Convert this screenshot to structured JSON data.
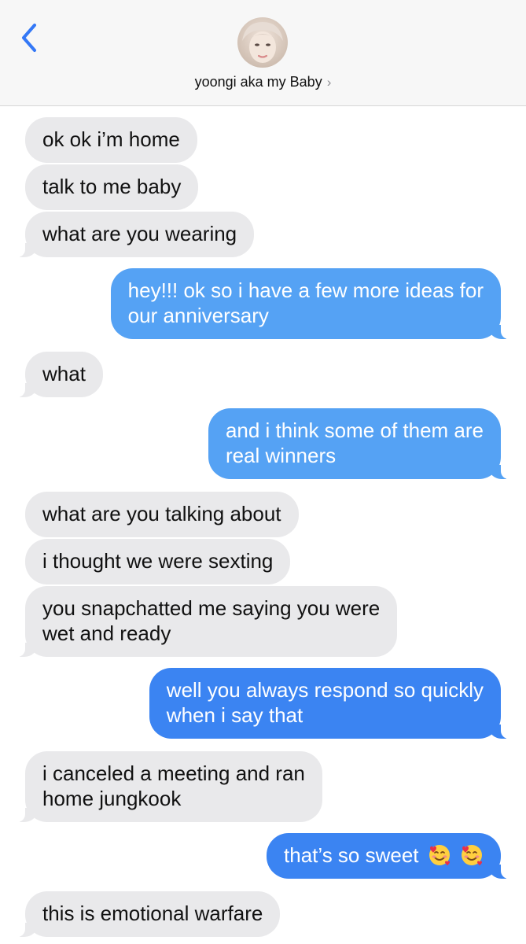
{
  "header": {
    "contact_name": "yoongi aka my Baby",
    "chevron": "›"
  },
  "messages": [
    {
      "side": "in",
      "text": "ok ok i’m home"
    },
    {
      "side": "in",
      "text": "talk to me baby"
    },
    {
      "side": "in",
      "text": "what are you wearing"
    },
    {
      "side": "out",
      "lines": [
        "hey!!! ok so i have a few more ideas for",
        "our anniversary"
      ]
    },
    {
      "side": "in",
      "text": "what"
    },
    {
      "side": "out",
      "lines": [
        "and i think some of them are",
        "real winners"
      ]
    },
    {
      "side": "in",
      "text": "what are you talking about"
    },
    {
      "side": "in",
      "text": "i thought we were sexting"
    },
    {
      "side": "in",
      "lines": [
        "you snapchatted me saying you were",
        "wet and ready"
      ]
    },
    {
      "side": "out",
      "lines": [
        "well you always respond so quickly",
        "when i say that"
      ]
    },
    {
      "side": "in",
      "lines": [
        "i canceled a meeting and ran",
        "home jungkook"
      ]
    },
    {
      "side": "out",
      "text": "that’s so sweet",
      "emoji": "smiling-face-with-hearts x2"
    },
    {
      "side": "in",
      "text": "this is emotional warfare"
    }
  ],
  "colors": {
    "incoming_bubble": "#e9e9eb",
    "outgoing_bubble_light": "#55a2f4",
    "outgoing_bubble_dark": "#3b84f2",
    "accent": "#3478f6"
  }
}
